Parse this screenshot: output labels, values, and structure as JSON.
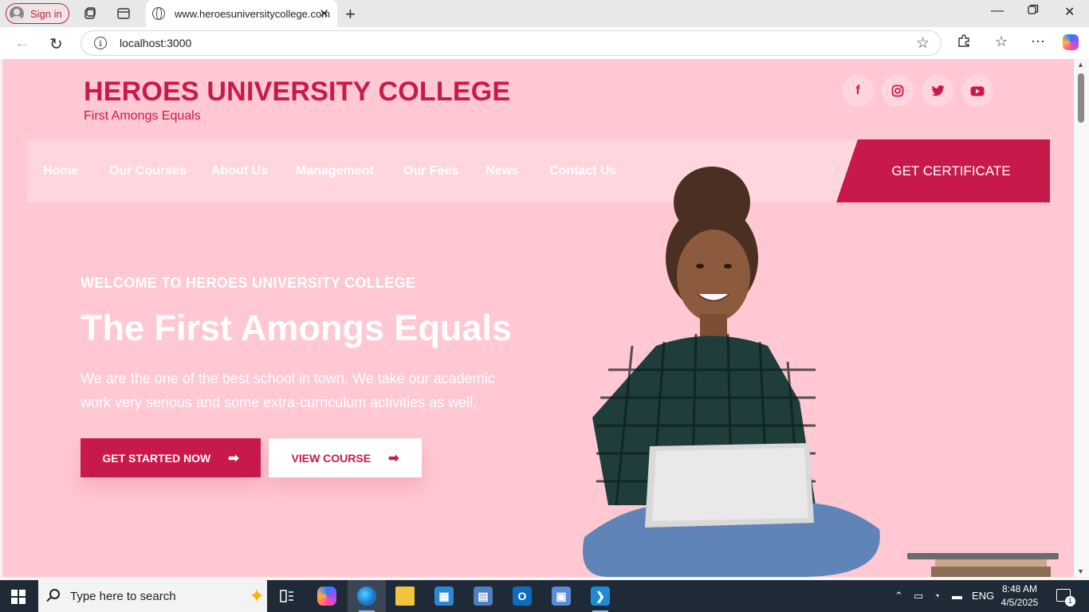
{
  "browser": {
    "sign_in_label": "Sign in",
    "tab_title": "www.heroesuniversitycollege.com",
    "url": "localhost:3000"
  },
  "site": {
    "brand": "HEROES UNIVERSITY COLLEGE",
    "tagline": "First Amongs Equals",
    "social": [
      "facebook",
      "instagram",
      "twitter",
      "youtube"
    ],
    "nav": [
      "Home",
      "Our Courses",
      "About Us",
      "Management",
      "Our Fees",
      "News",
      "Contact Us"
    ],
    "cta_certificate": "GET CERTIFICATE",
    "hero": {
      "welcome": "WELCOME TO HEROES UNIVERSITY COLLEGE",
      "title": "The First Amongs Equals",
      "description": "We are the one of the best school in town. We take our academic work very serious and some extra-curriculum activities as well.",
      "primary_button": "GET STARTED NOW",
      "secondary_button": "VIEW COURSE"
    },
    "colors": {
      "brand": "#c8194b",
      "background": "#ffc8d2",
      "navbar": "#ffd5de"
    }
  },
  "taskbar": {
    "search_placeholder": "Type here to search",
    "language": "ENG",
    "time": "8:48 AM",
    "date": "4/5/2025",
    "notifications": "1"
  }
}
